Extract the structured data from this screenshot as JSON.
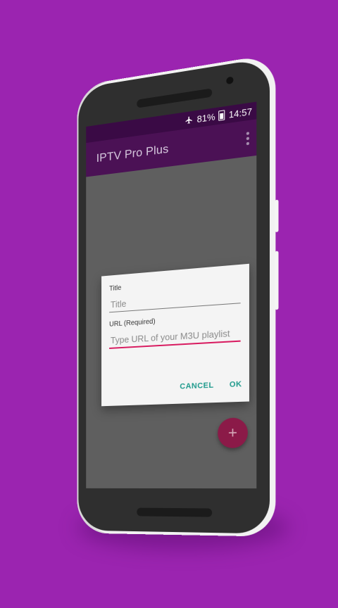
{
  "status_bar": {
    "battery": "81%",
    "time": "14:57",
    "icons": [
      "airplane-icon",
      "battery-icon"
    ]
  },
  "app_bar": {
    "title": "IPTV Pro Plus",
    "menu_icon": "overflow-menu-icon"
  },
  "dialog": {
    "title_label": "Title",
    "title_placeholder": "Title",
    "url_label": "URL (Required)",
    "url_placeholder": "Type URL of your M3U playlist",
    "cancel_label": "CANCEL",
    "ok_label": "OK"
  },
  "fab": {
    "label": "+",
    "icon": "plus-icon"
  },
  "colors": {
    "background": "#9b24b0",
    "app_bar": "#4b1155",
    "status_bar": "#3a0a45",
    "accent": "#1e9a8c",
    "input_active": "#d81b60",
    "fab": "#8b1a48"
  }
}
